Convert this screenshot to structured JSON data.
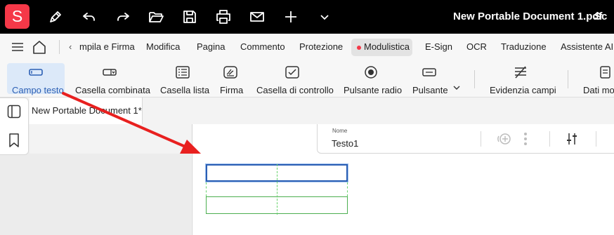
{
  "titlebar": {
    "app_logo": "S",
    "document_title": "New Portable Document 1.pdf",
    "title_tail": "Sc",
    "icons": [
      "pen-icon",
      "undo-icon",
      "redo-icon",
      "folder-open-icon",
      "save-icon",
      "print-icon",
      "mail-icon",
      "plus-icon",
      "chevron-down-icon"
    ]
  },
  "menubar": {
    "items": [
      "mpila e Firma",
      "Modifica",
      "Pagina",
      "Commento",
      "Protezione",
      "Modulistica",
      "E-Sign",
      "OCR",
      "Traduzione",
      "Assistente AI"
    ],
    "active": "Modulistica",
    "active_color": "#f53848"
  },
  "ribbon": {
    "items": [
      {
        "label": "Campo testo",
        "icon": "text-field-icon"
      },
      {
        "label": "Casella combinata",
        "icon": "combo-box-icon"
      },
      {
        "label": "Casella lista",
        "icon": "list-box-icon"
      },
      {
        "label": "Firma",
        "icon": "signature-icon"
      },
      {
        "label": "Casella di controllo",
        "icon": "checkbox-icon"
      },
      {
        "label": "Pulsante radio",
        "icon": "radio-button-icon"
      },
      {
        "label": "Pulsante",
        "icon": "button-icon"
      },
      {
        "label": "Evidenzia campi",
        "icon": "highlight-fields-icon"
      },
      {
        "label": "Dati mod",
        "icon": "form-data-icon"
      }
    ],
    "active": "Campo testo",
    "active_bg": "#dce9f9"
  },
  "tabs": {
    "document_tab": "New Portable Document 1*"
  },
  "property_bar": {
    "label": "Nome",
    "value": "Testo1"
  },
  "annotation": {
    "arrow_color": "#e8201f"
  }
}
